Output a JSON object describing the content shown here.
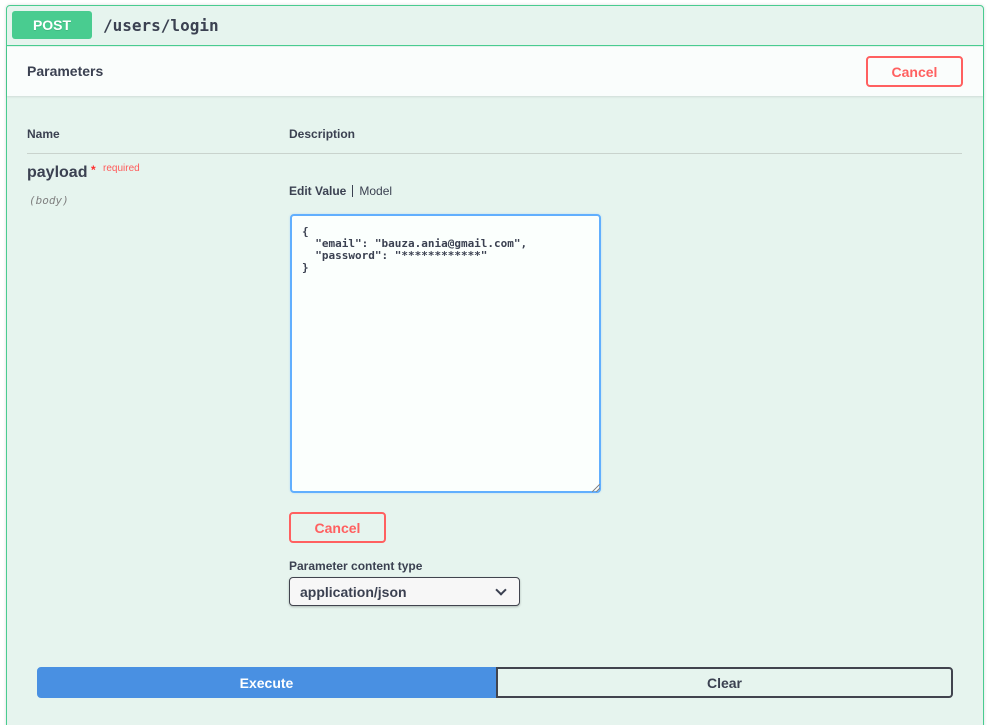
{
  "summary": {
    "method": "POST",
    "path": "/users/login"
  },
  "parameters": {
    "title": "Parameters",
    "cancel_label": "Cancel",
    "col_name": "Name",
    "col_description": "Description"
  },
  "param": {
    "name": "payload",
    "required_star": "*",
    "required_text": "required",
    "location": "(body)",
    "tab_edit_value": "Edit Value",
    "tab_model": "Model",
    "value": "{\n  \"email\": \"bauza.ania@gmail.com\",\n  \"password\": \"************\"\n}",
    "cancel_label": "Cancel",
    "content_type_label": "Parameter content type",
    "content_type": "application/json"
  },
  "actions": {
    "execute": "Execute",
    "clear": "Clear"
  },
  "colors": {
    "post": "#49cc90",
    "execute": "#4990e2",
    "cancel": "#ff6060",
    "editor_border": "#61affe"
  }
}
